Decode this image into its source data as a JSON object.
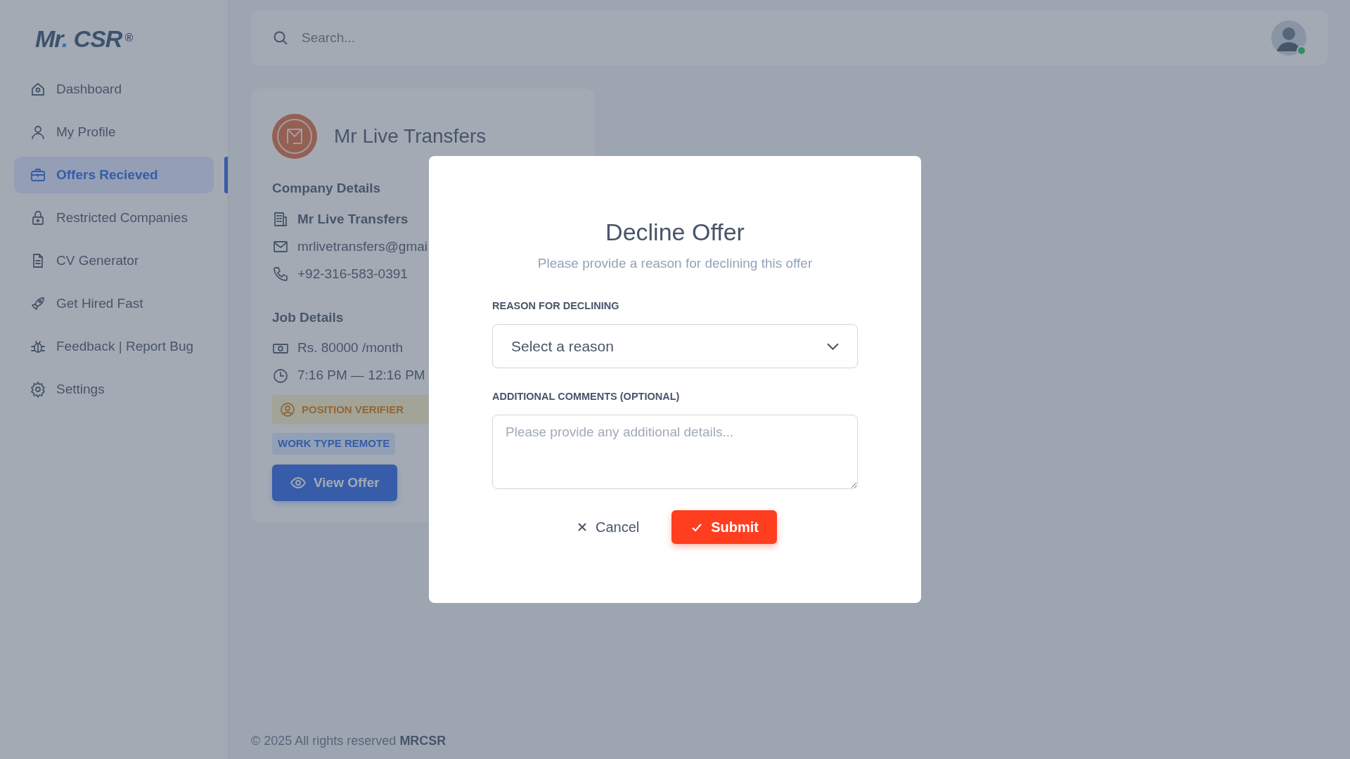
{
  "logo": {
    "prefix": "Mr",
    "dot": ".",
    "name": "CSR",
    "mark": "®"
  },
  "sidebar": {
    "items": [
      {
        "label": "Dashboard",
        "selected": false
      },
      {
        "label": "My Profile",
        "selected": false
      },
      {
        "label": "Offers Recieved",
        "selected": true
      },
      {
        "label": "Restricted Companies",
        "selected": false
      },
      {
        "label": "CV Generator",
        "selected": false
      },
      {
        "label": "Get Hired Fast",
        "selected": false
      },
      {
        "label": "Feedback | Report Bug",
        "selected": false
      },
      {
        "label": "Settings",
        "selected": false
      }
    ]
  },
  "search": {
    "placeholder": "Search..."
  },
  "user": {
    "online": true
  },
  "offer_card": {
    "company": "Mr Live Transfers",
    "company_details": {
      "title": "Company Details",
      "items": [
        "Mr Live Transfers",
        "mrlivetransfers@gmai",
        "+92-316-583-0391"
      ]
    },
    "job_details": {
      "title": "Job Details",
      "items": [
        "Rs. 80000 /month",
        "7:16 PM — 12:16 PM"
      ]
    },
    "badges": [
      {
        "kind": "verifier",
        "label": "POSITION VERIFIER"
      },
      {
        "kind": "work_type",
        "label": "WORK TYPE REMOTE"
      }
    ],
    "button": "View Offer"
  },
  "footer": {
    "text": "© 2025 All rights reserved",
    "brand": "MRCSR"
  },
  "modal": {
    "title": "Decline Offer",
    "subtitle": "Please provide a reason for declining this offer",
    "reason_label": "REASON FOR DECLINING",
    "reason_select": "Select a reason",
    "comments_label": "ADDITIONAL COMMENTS (OPTIONAL)",
    "comments_placeholder": "Please provide any additional details...",
    "cancel": "Cancel",
    "submit": "Submit"
  }
}
